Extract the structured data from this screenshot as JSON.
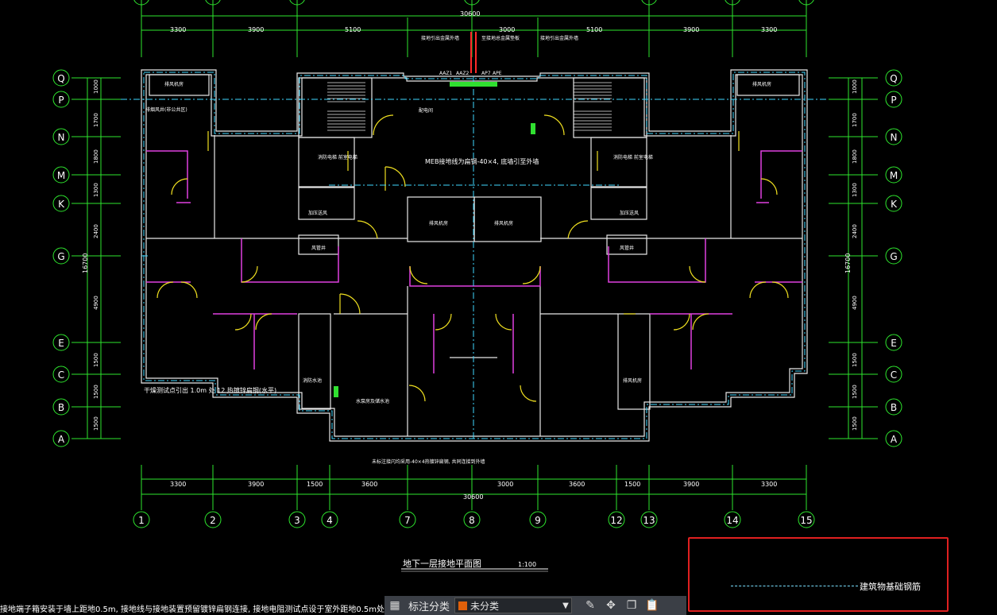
{
  "drawing": {
    "top_dims_total": "30600",
    "top_dims": [
      "3300",
      "3900",
      "5100",
      "3000",
      "5100",
      "3900",
      "3300"
    ],
    "bottom_dims_total": "30600",
    "bottom_dims": [
      "3300",
      "3900",
      "1500",
      "3600",
      "3000",
      "3600",
      "1500",
      "3900",
      "3300"
    ],
    "left_axis": [
      "Q",
      "P",
      "N",
      "M",
      "K",
      "G",
      "E",
      "C",
      "B",
      "A"
    ],
    "left_dims": [
      "1000",
      "1700",
      "1800",
      "1300",
      "2400",
      "4900",
      "1500",
      "1500",
      "1500"
    ],
    "left_total": "16700",
    "bottom_axis": [
      "1",
      "2",
      "3",
      "4",
      "7",
      "8",
      "9",
      "12",
      "13",
      "14",
      "15"
    ],
    "top_notes": [
      "接地引出金属外墙",
      "至接地总金属垫板",
      "接地引出金属外墙"
    ],
    "equipment_labels": [
      "AAZ1",
      "AAZ2",
      "AP7",
      "APE"
    ],
    "center_note": "MEB接地线为扁钢-40×4, 底墙引至外墙",
    "room_labels": {
      "left_top": "排风机房",
      "left_2": "排烟风井(非公共区)",
      "elevator_left": "消防电梯\n前室电梯",
      "elevator_right": "消防电梯\n前室电梯",
      "pipe_left": "加压送风",
      "pipe_right": "加压送风",
      "shaft_left": "风管井",
      "shaft_right": "风管井",
      "room_a": "排风机房",
      "room_b": "排风机房",
      "equip_room": "配电间",
      "right_low": "排风机房",
      "mid_low": "水泵房及储水池",
      "left_low": "消防水池"
    },
    "test_note": "干燥测试点引出 1.0m 处 12\n热镀锌扁钢(水平)",
    "bottom_center_note": "未标注接闪均采用-40×4热镀锌扁钢, 共同连接到外墙",
    "title": "地下一层接地平面图",
    "scale": "1:100",
    "footer_note": "接地端子箱安装于墙上距地0.5m, 接地线与接地装置预留镀锌扁钢连接, 接地电阻测试点设于室外距地0.5m处"
  },
  "legend": {
    "label": "建筑物基础钢筋"
  },
  "toolbar": {
    "grid_icon": "grid-icon",
    "label": "标注分类",
    "select_value": "未分类",
    "select_color": "#e0600a",
    "tools": [
      "edit-icon",
      "move-icon",
      "copy-icon",
      "paste-icon"
    ]
  }
}
